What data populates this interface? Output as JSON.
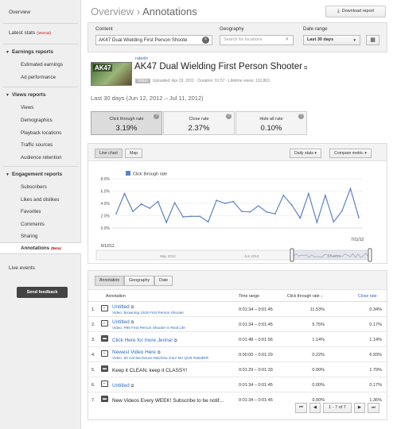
{
  "sidebar": {
    "overview": "Overview",
    "latest_stats": "Latest stats",
    "latest_stats_tag": "(internal)",
    "earnings_head": "Earnings reports",
    "earnings_items": [
      "Estimated earnings",
      "Ad performance"
    ],
    "views_head": "Views reports",
    "views_items": [
      "Views",
      "Demographics",
      "Playback locations",
      "Traffic sources",
      "Audience retention"
    ],
    "engagement_head": "Engagement reports",
    "engagement_items": [
      "Subscribers",
      "Likes and dislikes",
      "Favorites",
      "Comments",
      "Sharing"
    ],
    "annotations": "Annotations",
    "annotations_tag": "(Beta)",
    "live_events": "Live events",
    "feedback": "Send feedback"
  },
  "header": {
    "crumb": "Overview",
    "separator": "›",
    "title": "Annotations",
    "download": "Download report"
  },
  "filters": {
    "content_label": "Content",
    "content_value": "AK47 Dual Wielding First Person Shoote",
    "geo_label": "Geography",
    "geo_placeholder": "Search for locations",
    "date_label": "Date range",
    "date_value": "Last 30 days"
  },
  "video": {
    "thumb_text": "AK47",
    "user": "ratedrr",
    "title": "AK47 Dual Wielding First Person Shooter",
    "badge": "Video",
    "uploaded": "Uploaded: Apr 29, 2011",
    "duration": "Duration: 01:57",
    "lifetime": "Lifetime views: 110,863"
  },
  "range_text": "Last 30 days (Jun 12, 2012 – Jul 11, 2012)",
  "metrics": [
    {
      "label": "Click through rate",
      "value": "3.19%"
    },
    {
      "label": "Close rate",
      "value": "2.37%"
    },
    {
      "label": "Hide all rate",
      "value": "0.10%"
    }
  ],
  "chart_toolbar": {
    "line_chart": "Line chart",
    "map": "Map",
    "daily": "Daily stats",
    "compare": "Compare metric"
  },
  "chart_data": {
    "type": "line",
    "legend": "Click through rate",
    "ylim": [
      0,
      8
    ],
    "yticks": [
      "8.0%",
      "6.0%",
      "4.0%",
      "2.0%",
      "0.0%"
    ],
    "x_start_label": "6/12/12",
    "x_end_label": "7/11/12",
    "nav_labels": [
      "May 2012",
      "Jun 2012",
      "Jul 2012"
    ],
    "values": [
      2.3,
      5.6,
      2.7,
      3.9,
      3.2,
      4.3,
      0.9,
      4.1,
      1.8,
      1.9,
      1.9,
      1.0,
      4.5,
      4.0,
      4.3,
      2.7,
      2.6,
      3.6,
      2.6,
      2.3,
      5.3,
      3.7,
      1.6,
      5.6,
      0.9,
      5.3,
      1.0,
      2.8,
      6.4,
      1.7
    ],
    "color": "#5b83c4"
  },
  "table": {
    "tabs": [
      "Annotation",
      "Geography",
      "Date"
    ],
    "headers": {
      "annotation": "Annotation",
      "time": "Time range",
      "ctr": "Click through rate",
      "close": "Close rate"
    },
    "sort_arrow": "↓",
    "rows": [
      {
        "num": "1.",
        "name": "Untitled",
        "video": "Video: Browning 1919 First Person Shooter",
        "time": "0:01:34 – 0:01:45",
        "ctr": "11.53%",
        "close": "0.34%"
      },
      {
        "num": "2.",
        "name": "Untitled",
        "video": "Video: P90 First Person Shooter in Real Life",
        "time": "0:01:34 – 0:01:45",
        "ctr": "5.75%",
        "close": "0.17%"
      },
      {
        "num": "3.",
        "name": "Click Here for more Jenna!",
        "video": "",
        "time": "0:01:48 – 0:01:56",
        "ctr": "1.14%",
        "close": "1.14%"
      },
      {
        "num": "4.",
        "name": "Newest Video Here",
        "video": "Video: 50 Cal Ma Deuce Machine Gun! M2 QCB RatedRR",
        "time": "0:00:00 – 0:01:29",
        "ctr": "0.22%",
        "close": "6.93%"
      },
      {
        "num": "5.",
        "name": "Keep it CLEAN, keep it CLASSY!",
        "video": "",
        "time": "0:01:29 – 0:01:33",
        "ctr": "0.00%",
        "close": "1.79%"
      },
      {
        "num": "6.",
        "name": "Untitled",
        "video": "",
        "time": "0:01:34 – 0:01:45",
        "ctr": "0.00%",
        "close": "0.17%"
      },
      {
        "num": "7.",
        "name": "New Videos Every WEEK! Subscribe to be notif…",
        "video": "",
        "time": "0:01:34 – 0:01:45",
        "ctr": "0.00%",
        "close": "1.36%"
      }
    ],
    "pager": "1 - 7 of 7"
  }
}
